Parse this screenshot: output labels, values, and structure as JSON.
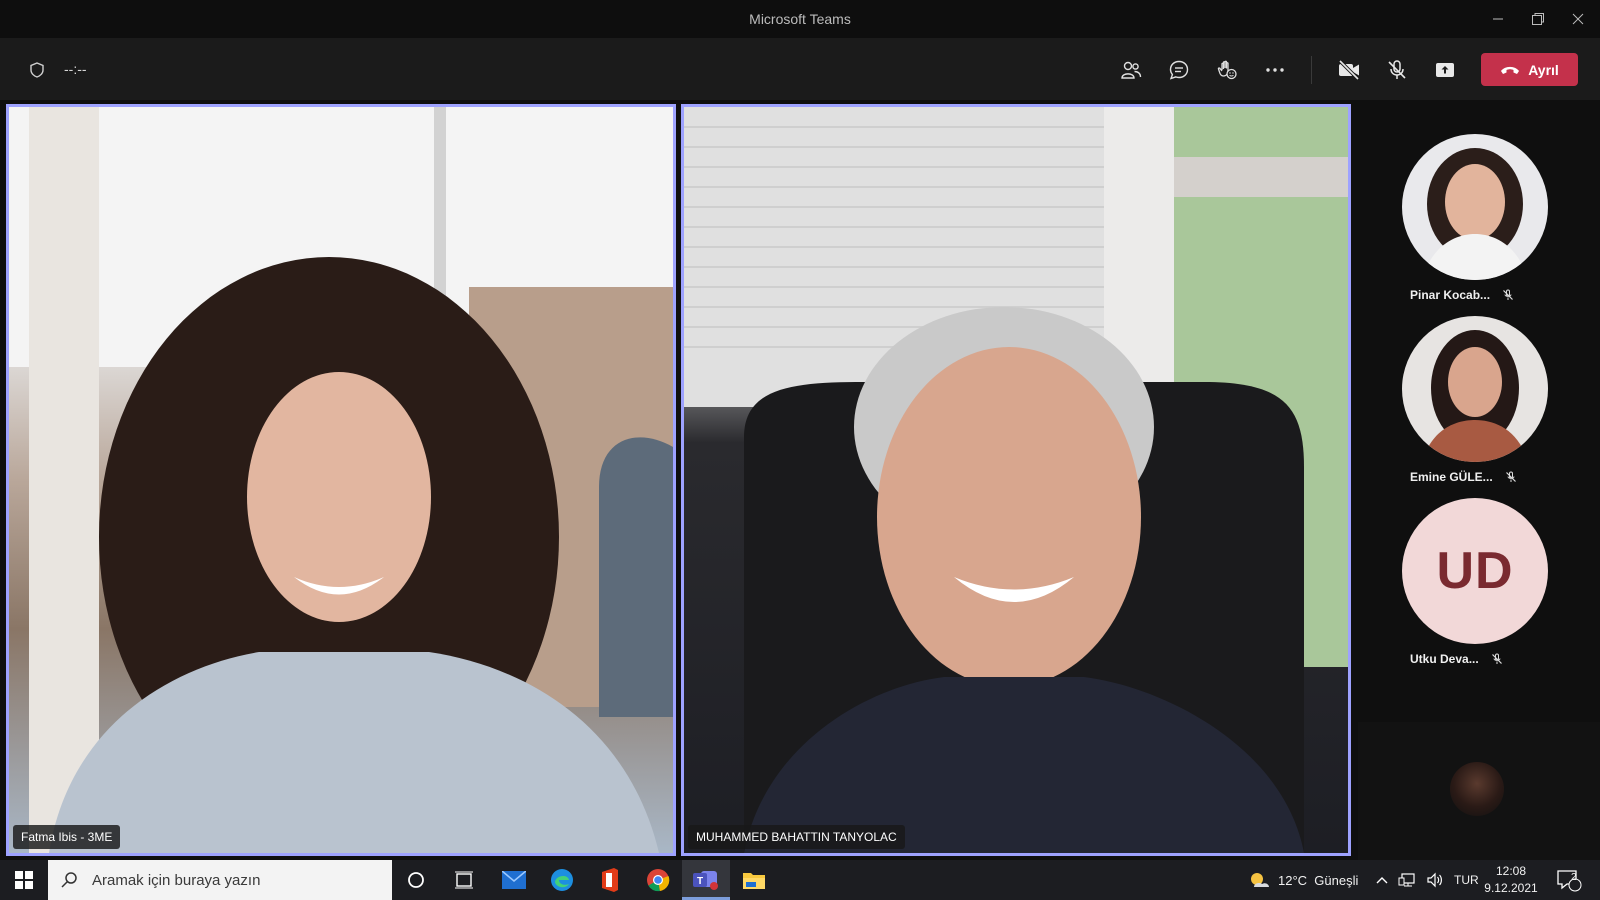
{
  "window": {
    "title": "Microsoft Teams"
  },
  "meeting": {
    "timer": "--:--"
  },
  "toolbar": {
    "leave_label": "Ayrıl"
  },
  "tiles": [
    {
      "name": "Fatma Ibis - 3ME"
    },
    {
      "name": "MUHAMMED BAHATTIN TANYOLAC"
    }
  ],
  "roster": [
    {
      "name": "Pinar Kocab...",
      "muted": true
    },
    {
      "name": "Emine GÜLE...",
      "muted": true
    },
    {
      "name": "Utku Deva...",
      "initials": "UD",
      "muted": true
    }
  ],
  "taskbar": {
    "search_placeholder": "Aramak için buraya yazın",
    "weather": "12°C  Güneşli",
    "language": "TUR",
    "time": "12:08",
    "date": "9.12.2021",
    "notifications": "2"
  },
  "colors": {
    "accent_border": "#9ea2ff",
    "leave_red": "#c4314b"
  }
}
